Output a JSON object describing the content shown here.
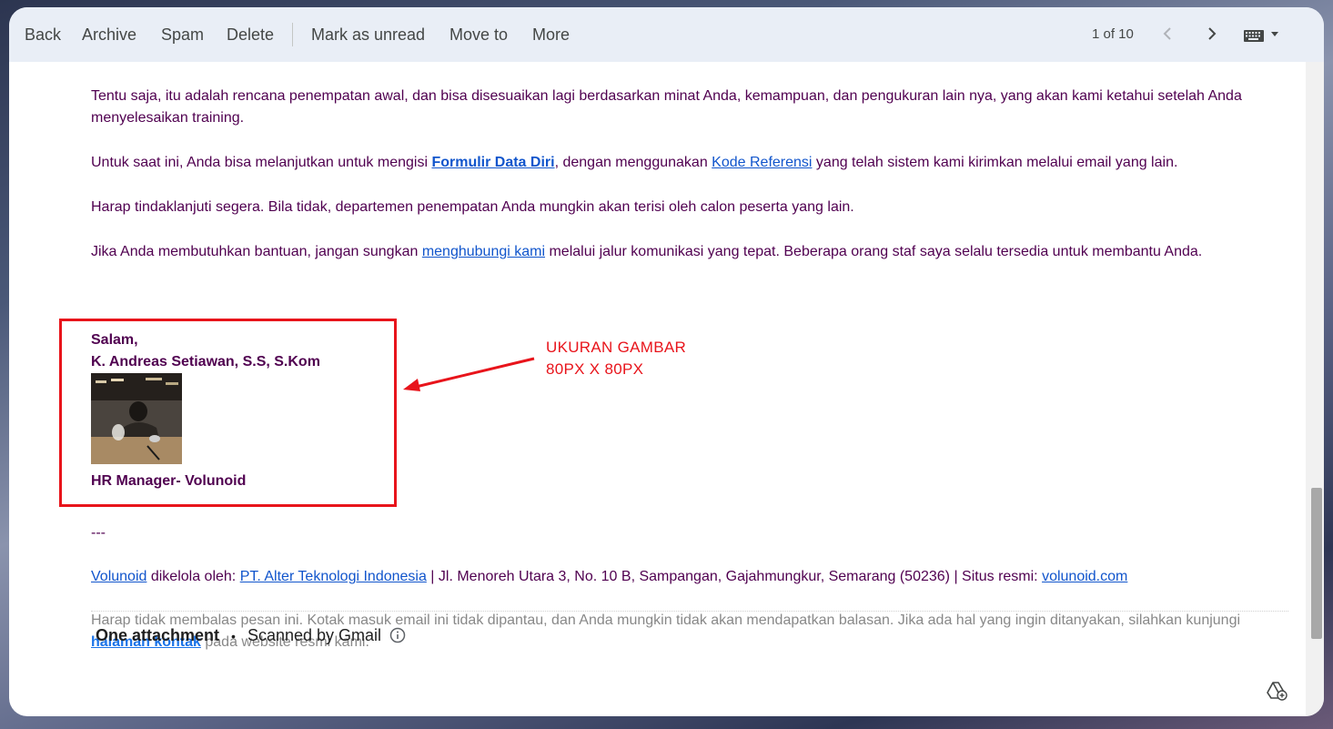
{
  "toolbar": {
    "back": "Back",
    "archive": "Archive",
    "spam": "Spam",
    "delete": "Delete",
    "mark_unread": "Mark as unread",
    "move_to": "Move to",
    "more": "More",
    "pager": "1 of 10",
    "icons": [
      "chevron-left-icon",
      "chevron-right-icon",
      "keyboard-icon",
      "caret-down-icon"
    ]
  },
  "email": {
    "p1": "Tentu saja, itu adalah rencana penempatan awal, dan bisa disesuaikan lagi berdasarkan minat Anda, kemampuan, dan pengukuran lain nya, yang akan kami ketahui setelah Anda menyelesaikan training.",
    "p2_a": "Untuk saat ini, Anda bisa melanjutkan untuk mengisi ",
    "p2_link1": "Formulir Data Diri",
    "p2_b": ", dengan menggunakan ",
    "p2_link2": "Kode Referensi",
    "p2_c": " yang telah sistem kami kirimkan melalui email yang lain.",
    "p3": "Harap tindaklanjuti segera. Bila tidak, departemen penempatan Anda mungkin akan terisi oleh calon peserta yang lain.",
    "p4_a": "Jika Anda membutuhkan bantuan, jangan sungkan ",
    "p4_link": "menghubungi kami",
    "p4_b": " melalui jalur komunikasi yang tepat. Beberapa orang staf saya selalu tersedia untuk membantu Anda.",
    "sig_greeting": "Salam,",
    "sig_name": "K. Andreas Setiawan, S.S, S.Kom",
    "sig_title": "HR Manager- Volunoid",
    "separator": "---",
    "footer_link1": "Volunoid",
    "footer_a": " dikelola oleh: ",
    "footer_link2": "PT. Alter Teknologi Indonesia",
    "footer_b": " | Jl. Menoreh Utara 3, No. 10 B, Sampangan, Gajahmungkur, Semarang (50236) | Situs resmi: ",
    "footer_link3": "volunoid.com",
    "note_a": "Harap tidak membalas pesan ini. Kotak masuk email ini tidak dipantau, dan Anda mungkin tidak akan mendapatkan balasan. Jika ada hal yang ingin ditanyakan, silahkan kunjungi ",
    "note_link": "halaman kontak",
    "note_b": " pada website resmi kami."
  },
  "annotation": {
    "line1": "UKURAN GAMBAR",
    "line2": "80PX X 80PX",
    "color": "#e8141b"
  },
  "attachments": {
    "label": "One attachment",
    "dot": "•",
    "scanned": "Scanned by Gmail",
    "icons": [
      "info-icon",
      "add-to-drive-icon"
    ]
  },
  "colors": {
    "toolbar_bg": "#e9eef6",
    "body_text": "#500050",
    "link": "#1155cc"
  }
}
